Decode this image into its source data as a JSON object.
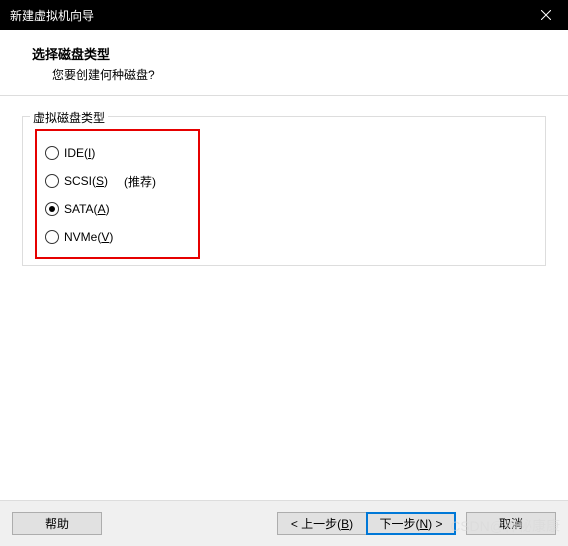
{
  "window": {
    "title": "新建虚拟机向导"
  },
  "header": {
    "title": "选择磁盘类型",
    "subtitle": "您要创建何种磁盘?"
  },
  "fieldset": {
    "label": "虚拟磁盘类型"
  },
  "options": {
    "ide": {
      "prefix": "IDE(",
      "key": "I",
      "suffix": ")",
      "selected": false
    },
    "scsi": {
      "prefix": "SCSI(",
      "key": "S",
      "suffix": ")",
      "selected": false,
      "hint": "(推荐)"
    },
    "sata": {
      "prefix": "SATA(",
      "key": "A",
      "suffix": ")",
      "selected": true
    },
    "nvme": {
      "prefix": "NVMe(",
      "key": "V",
      "suffix": ")",
      "selected": false
    }
  },
  "buttons": {
    "help": "帮助",
    "back": {
      "prefix": "< 上一步(",
      "key": "B",
      "suffix": ")"
    },
    "next": {
      "prefix": "下一步(",
      "key": "N",
      "suffix": ") >"
    },
    "cancel": "取消"
  },
  "watermark": "CSDN@神秘康康"
}
